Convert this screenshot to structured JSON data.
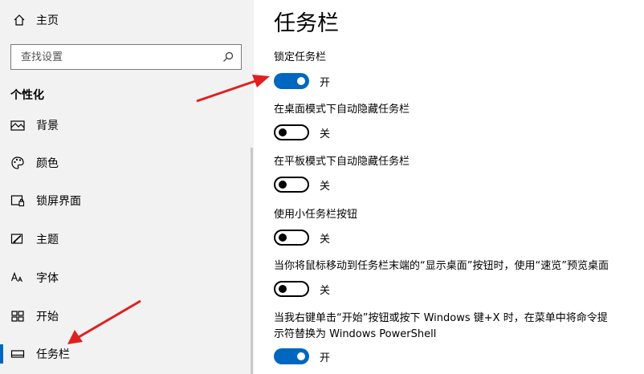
{
  "sidebar": {
    "home_label": "主页",
    "search_placeholder": "查找设置",
    "section_title": "个性化",
    "items": [
      {
        "label": "背景",
        "icon": "background-icon"
      },
      {
        "label": "颜色",
        "icon": "palette-icon"
      },
      {
        "label": "锁屏界面",
        "icon": "lockscreen-icon"
      },
      {
        "label": "主题",
        "icon": "themes-icon"
      },
      {
        "label": "字体",
        "icon": "fonts-icon"
      },
      {
        "label": "开始",
        "icon": "start-icon"
      },
      {
        "label": "任务栏",
        "icon": "taskbar-icon",
        "active": true
      }
    ]
  },
  "main": {
    "title": "任务栏",
    "settings": [
      {
        "label": "锁定任务栏",
        "state": "on",
        "state_label": "开"
      },
      {
        "label": "在桌面模式下自动隐藏任务栏",
        "state": "off",
        "state_label": "关"
      },
      {
        "label": "在平板模式下自动隐藏任务栏",
        "state": "off",
        "state_label": "关"
      },
      {
        "label": "使用小任务栏按钮",
        "state": "off",
        "state_label": "关"
      },
      {
        "label": "当你将鼠标移动到任务栏末端的“显示桌面”按钮时，使用“速览”预览桌面",
        "state": "off",
        "state_label": "关"
      },
      {
        "label_line1": "当我右键单击“开始”按钮或按下 Windows 键+X 时，在菜单中将命令提",
        "label_line2": "示符替换为 Windows PowerShell",
        "state": "on",
        "state_label": "开"
      }
    ]
  },
  "colors": {
    "accent": "#0067c0",
    "annotation_arrow": "#e02020"
  }
}
